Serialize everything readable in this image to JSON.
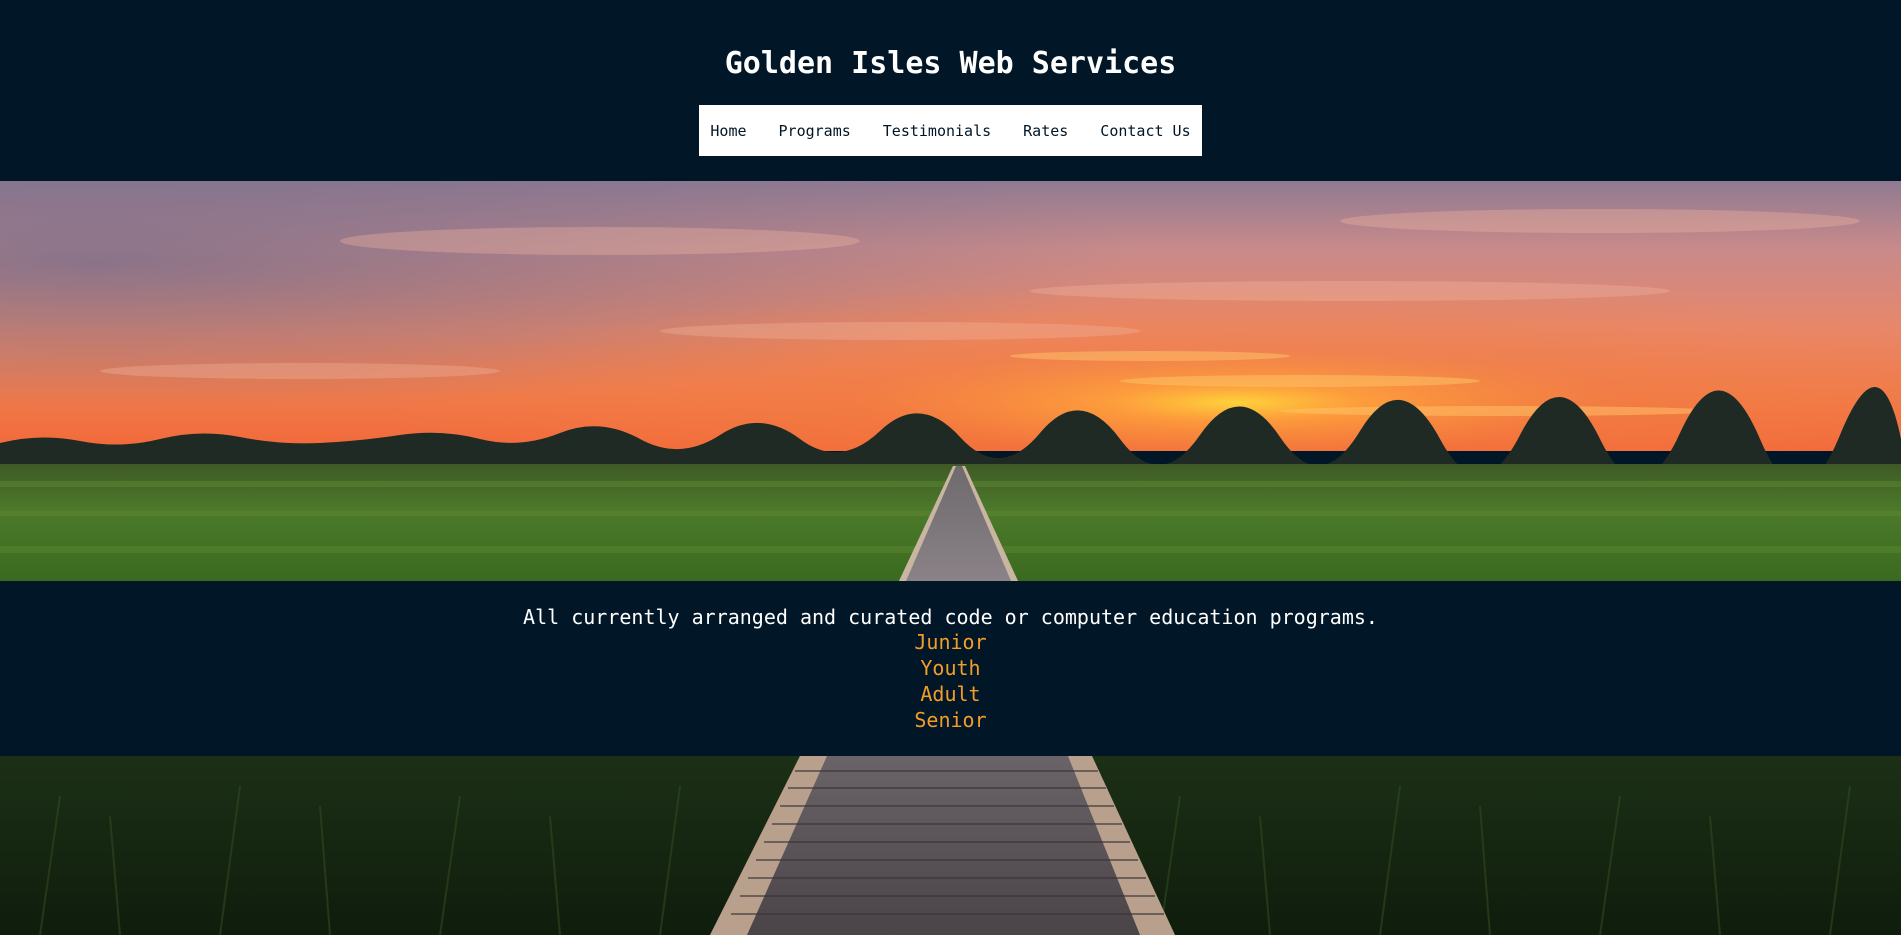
{
  "site": {
    "title": "Golden Isles Web Services"
  },
  "nav": {
    "items": [
      {
        "label": "Home"
      },
      {
        "label": "Programs"
      },
      {
        "label": "Testimonials"
      },
      {
        "label": "Rates"
      },
      {
        "label": "Contact Us"
      }
    ]
  },
  "programs": {
    "intro": "All currently arranged and curated code or computer education programs.",
    "items": [
      {
        "label": "Junior"
      },
      {
        "label": "Youth"
      },
      {
        "label": "Adult"
      },
      {
        "label": "Senior"
      }
    ]
  },
  "colors": {
    "background": "#011627",
    "nav_background": "#ffffff",
    "text": "#ffffff",
    "link_accent": "#f39c2a"
  },
  "images": {
    "hero": "sunset-marsh-boardwalk-photo",
    "background": "boardwalk-grass-photo"
  }
}
